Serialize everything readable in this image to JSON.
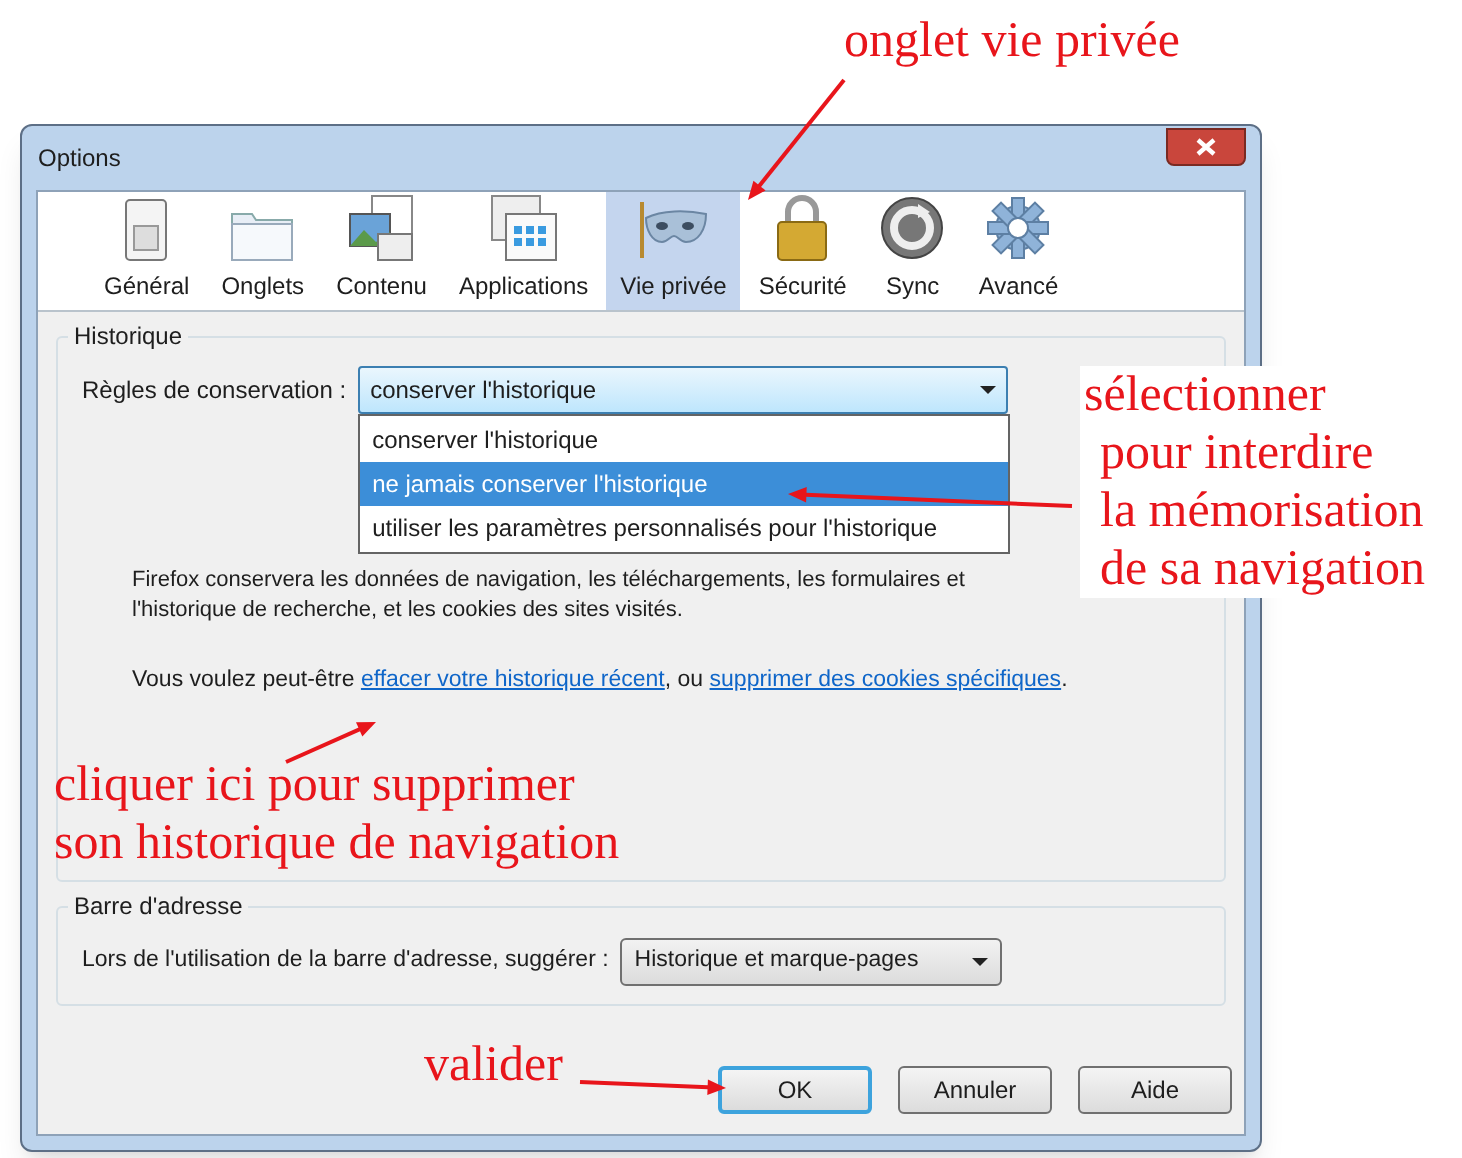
{
  "window": {
    "title": "Options"
  },
  "tabs": [
    {
      "label": "Général",
      "selected": false
    },
    {
      "label": "Onglets",
      "selected": false
    },
    {
      "label": "Contenu",
      "selected": false
    },
    {
      "label": "Applications",
      "selected": false
    },
    {
      "label": "Vie privée",
      "selected": true
    },
    {
      "label": "Sécurité",
      "selected": false
    },
    {
      "label": "Sync",
      "selected": false
    },
    {
      "label": "Avancé",
      "selected": false
    }
  ],
  "history": {
    "legend": "Historique",
    "rule_label": "Règles de conservation :",
    "rule_value": "conserver l'historique",
    "dropdown_open": true,
    "options": [
      {
        "label": "conserver l'historique",
        "selected": false
      },
      {
        "label": "ne jamais conserver l'historique",
        "selected": true
      },
      {
        "label": "utiliser les paramètres personnalisés pour l'historique",
        "selected": false
      }
    ],
    "description": "Firefox conservera les données de navigation, les téléchargements, les formulaires et l'historique de recherche, et les cookies des sites visités.",
    "links_prefix": "Vous voulez peut-être",
    "link_1": "effacer votre historique récent",
    "separator": ", ou",
    "link_2": "supprimer des cookies spécifiques",
    "suffix": "."
  },
  "address_bar": {
    "legend": "Barre d'adresse",
    "label": "Lors de l'utilisation de la barre d'adresse, suggérer :",
    "value": "Historique et marque-pages"
  },
  "buttons": [
    {
      "label": "OK",
      "default": true
    },
    {
      "label": "Annuler",
      "default": false
    },
    {
      "label": "Aide",
      "default": false
    }
  ],
  "annotations": [
    {
      "lines": [
        "onglet vie privée"
      ]
    },
    {
      "lines": [
        "sélectionner",
        "pour interdire",
        "la mémorisation",
        "de sa navigation"
      ]
    },
    {
      "lines": [
        "cliquer ici pour supprimer",
        "son historique de navigation"
      ]
    },
    {
      "lines": [
        "valider"
      ]
    }
  ]
}
